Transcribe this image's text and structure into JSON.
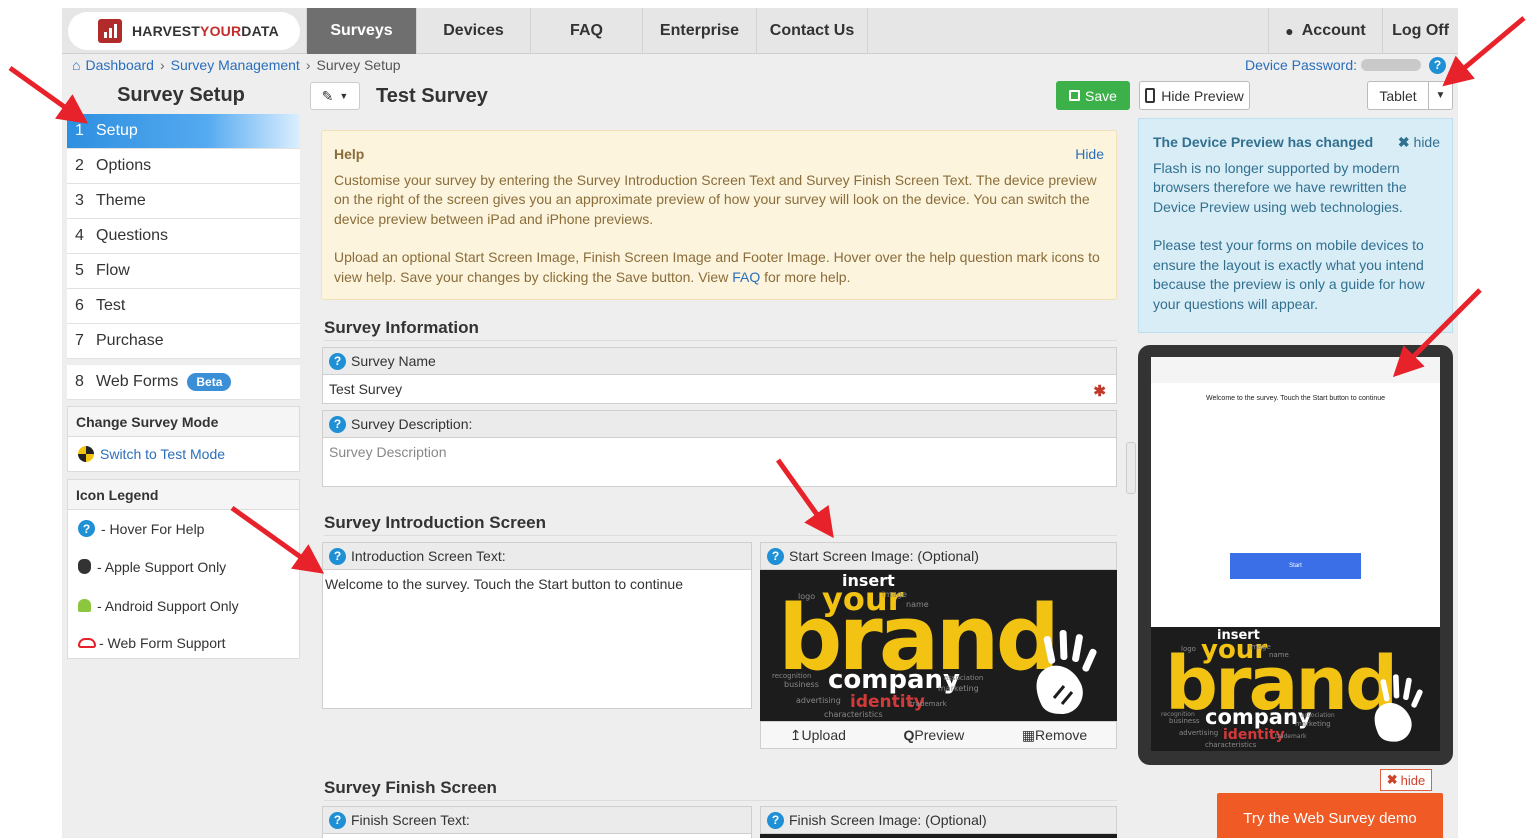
{
  "nav": {
    "logo_a": "HARVEST",
    "logo_b": "YOUR",
    "logo_c": "DATA",
    "tabs": [
      "Surveys",
      "Devices",
      "FAQ",
      "Enterprise",
      "Contact Us"
    ],
    "account": "Account",
    "logoff": "Log Off"
  },
  "breadcrumb": [
    "Dashboard",
    "Survey Management",
    "Survey Setup"
  ],
  "device_password_label": "Device Password:",
  "sidebar": {
    "title": "Survey Setup",
    "steps": [
      {
        "num": "1",
        "label": "Setup"
      },
      {
        "num": "2",
        "label": "Options"
      },
      {
        "num": "3",
        "label": "Theme"
      },
      {
        "num": "4",
        "label": "Questions"
      },
      {
        "num": "5",
        "label": "Flow"
      },
      {
        "num": "6",
        "label": "Test"
      },
      {
        "num": "7",
        "label": "Purchase"
      },
      {
        "num": "8",
        "label": "Web Forms",
        "badge": "Beta"
      }
    ],
    "mode_title": "Change Survey Mode",
    "mode_link": "Switch to Test Mode",
    "legend_title": "Icon Legend",
    "legend": [
      "- Hover For Help",
      "- Apple Support Only",
      "- Android Support Only",
      "- Web Form Support"
    ]
  },
  "toolbar": {
    "title": "Test Survey",
    "save": "Save",
    "hide_preview": "Hide Preview",
    "device": "Tablet"
  },
  "help": {
    "title": "Help",
    "hide": "Hide",
    "p1": "Customise your survey by entering the Survey Introduction Screen Text and Survey Finish Screen Text. The device preview on the right of the screen gives you an approximate preview of how your survey will look on the device. You can switch the device preview between iPad and iPhone previews.",
    "p2_a": "Upload an optional Start Screen Image, Finish Screen Image and Footer Image. Hover over the help question mark icons to view help. Save your changes by clicking the Save button. View ",
    "p2_link": "FAQ",
    "p2_b": " for more help."
  },
  "survey_info": {
    "heading": "Survey Information",
    "name_label": "Survey Name",
    "name_value": "Test Survey",
    "desc_label": "Survey Description:",
    "desc_placeholder": "Survey Description"
  },
  "intro": {
    "heading": "Survey Introduction Screen",
    "text_label": "Introduction Screen Text:",
    "text_value": "Welcome to the survey. Touch the Start button to continue",
    "image_label": "Start Screen Image: (Optional)",
    "upload": "Upload",
    "preview": "Preview",
    "remove": "Remove"
  },
  "brand_image": {
    "insert": "insert",
    "your": "your",
    "brand": "brand",
    "company": "company",
    "identity": "identity",
    "small": [
      "logo",
      "image",
      "name",
      "business",
      "marketing",
      "advertising",
      "trademark",
      "characteristics",
      "recognition",
      "association"
    ]
  },
  "finish": {
    "heading": "Survey Finish Screen",
    "text_label": "Finish Screen Text:",
    "image_label": "Finish Screen Image: (Optional)"
  },
  "info": {
    "title": "The Device Preview has changed",
    "hide": "hide",
    "p1": "Flash is no longer supported by modern browsers therefore we have rewritten the Device Preview using web technologies.",
    "p2": "Please test your forms on mobile devices to ensure the layout is exactly what you intend because the preview is only a guide for how your questions will appear."
  },
  "preview": {
    "text": "Welcome to the survey. Touch the Start button to continue",
    "start": "Start"
  },
  "bottom": {
    "hide": "hide",
    "demo": "Try the Web Survey demo"
  },
  "colors": {
    "accent": "#2a6ebb",
    "save_green": "#3cb14a",
    "demo_orange": "#f05a24",
    "arrow_red": "#e8222a",
    "brand_yellow": "#f2c313"
  }
}
